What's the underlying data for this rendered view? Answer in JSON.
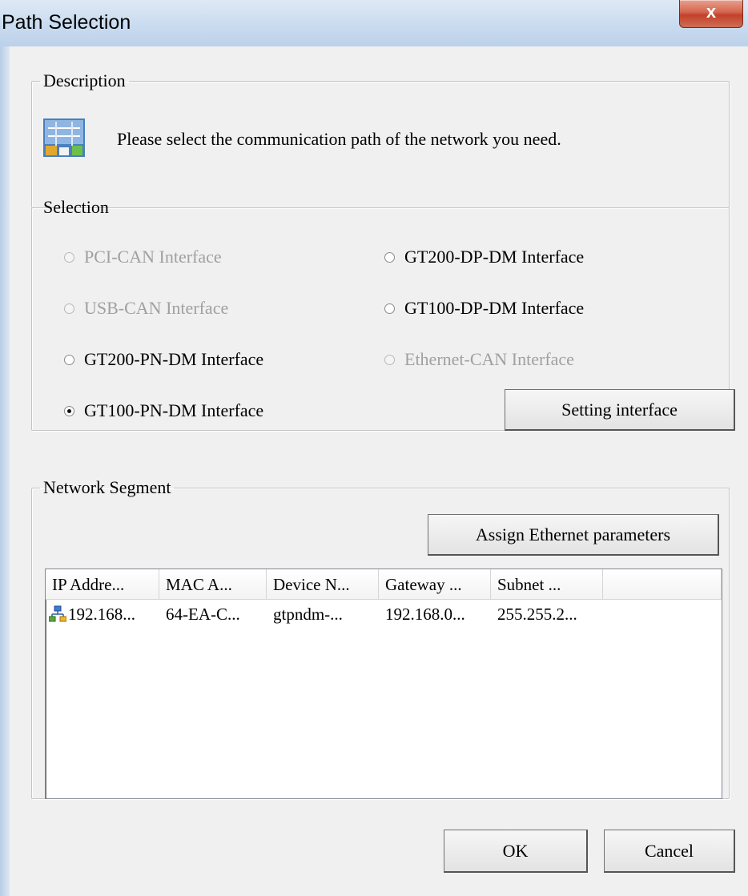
{
  "window": {
    "title": "Path Selection",
    "close_glyph": "x"
  },
  "description": {
    "legend": "Description",
    "icon": "network-path-icon",
    "text": "Please select the communication path of the network you need."
  },
  "selection": {
    "legend": "Selection",
    "options": [
      {
        "label": "PCI-CAN Interface",
        "enabled": false,
        "checked": false
      },
      {
        "label": "GT200-DP-DM Interface",
        "enabled": true,
        "checked": false
      },
      {
        "label": "USB-CAN Interface",
        "enabled": false,
        "checked": false
      },
      {
        "label": "GT100-DP-DM Interface",
        "enabled": true,
        "checked": false
      },
      {
        "label": "GT200-PN-DM Interface",
        "enabled": true,
        "checked": false
      },
      {
        "label": "Ethernet-CAN Interface",
        "enabled": false,
        "checked": false
      },
      {
        "label": "GT100-PN-DM Interface",
        "enabled": true,
        "checked": true
      }
    ],
    "setting_button": "Setting interface"
  },
  "network_segment": {
    "legend": "Network Segment",
    "assign_button": "Assign Ethernet parameters",
    "columns": [
      "IP Addre...",
      "MAC A...",
      "Device N...",
      "Gateway ...",
      "Subnet ..."
    ],
    "rows": [
      {
        "icon": "network-device-icon",
        "cells": [
          "192.168...",
          "64-EA-C...",
          "gtpndm-...",
          "192.168.0...",
          "255.255.2..."
        ]
      }
    ]
  },
  "footer": {
    "ok_label": "OK",
    "cancel_label": "Cancel"
  },
  "colors": {
    "titlebar": "#c9dbef",
    "close_button": "#c2412a",
    "disabled_text": "#a0a0a0",
    "face": "#f0f0f0"
  }
}
